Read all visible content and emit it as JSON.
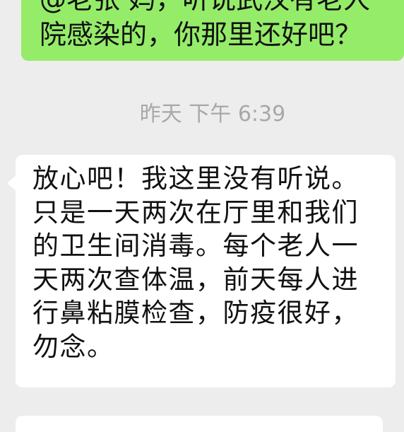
{
  "messages": {
    "outgoing": {
      "line1": "@老张 妈，听说武汉有老人",
      "line2": "院感染的，你那里还好吧？"
    },
    "timestamp": "昨天 下午 6:39",
    "incoming": {
      "lines": [
        "放心吧！我这里没有听说。",
        "只是一天两次在厅里和我们",
        "的卫生间消毒。每个老人一",
        "天两次查体温，前天每人进",
        "行鼻粘膜检查，防疫很好，",
        "勿念。"
      ]
    }
  },
  "colors": {
    "background": "#ededed",
    "outgoing_bubble": "#95ec69",
    "incoming_bubble": "#ffffff",
    "timestamp_text": "#a8a8a8"
  }
}
